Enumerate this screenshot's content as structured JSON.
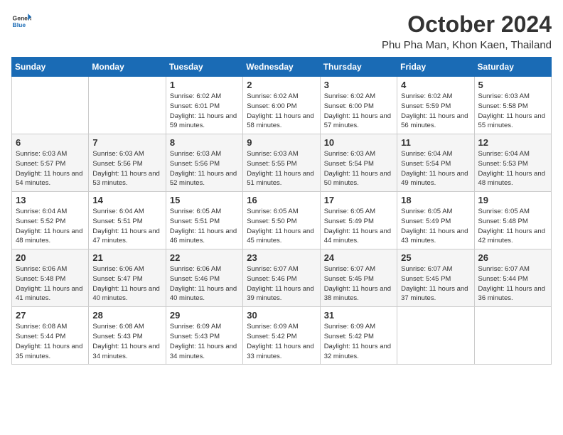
{
  "header": {
    "logo_general": "General",
    "logo_blue": "Blue",
    "month_title": "October 2024",
    "location": "Phu Pha Man, Khon Kaen, Thailand"
  },
  "weekdays": [
    "Sunday",
    "Monday",
    "Tuesday",
    "Wednesday",
    "Thursday",
    "Friday",
    "Saturday"
  ],
  "weeks": [
    [
      {
        "day": "",
        "info": ""
      },
      {
        "day": "",
        "info": ""
      },
      {
        "day": "1",
        "info": "Sunrise: 6:02 AM\nSunset: 6:01 PM\nDaylight: 11 hours and 59 minutes."
      },
      {
        "day": "2",
        "info": "Sunrise: 6:02 AM\nSunset: 6:00 PM\nDaylight: 11 hours and 58 minutes."
      },
      {
        "day": "3",
        "info": "Sunrise: 6:02 AM\nSunset: 6:00 PM\nDaylight: 11 hours and 57 minutes."
      },
      {
        "day": "4",
        "info": "Sunrise: 6:02 AM\nSunset: 5:59 PM\nDaylight: 11 hours and 56 minutes."
      },
      {
        "day": "5",
        "info": "Sunrise: 6:03 AM\nSunset: 5:58 PM\nDaylight: 11 hours and 55 minutes."
      }
    ],
    [
      {
        "day": "6",
        "info": "Sunrise: 6:03 AM\nSunset: 5:57 PM\nDaylight: 11 hours and 54 minutes."
      },
      {
        "day": "7",
        "info": "Sunrise: 6:03 AM\nSunset: 5:56 PM\nDaylight: 11 hours and 53 minutes."
      },
      {
        "day": "8",
        "info": "Sunrise: 6:03 AM\nSunset: 5:56 PM\nDaylight: 11 hours and 52 minutes."
      },
      {
        "day": "9",
        "info": "Sunrise: 6:03 AM\nSunset: 5:55 PM\nDaylight: 11 hours and 51 minutes."
      },
      {
        "day": "10",
        "info": "Sunrise: 6:03 AM\nSunset: 5:54 PM\nDaylight: 11 hours and 50 minutes."
      },
      {
        "day": "11",
        "info": "Sunrise: 6:04 AM\nSunset: 5:54 PM\nDaylight: 11 hours and 49 minutes."
      },
      {
        "day": "12",
        "info": "Sunrise: 6:04 AM\nSunset: 5:53 PM\nDaylight: 11 hours and 48 minutes."
      }
    ],
    [
      {
        "day": "13",
        "info": "Sunrise: 6:04 AM\nSunset: 5:52 PM\nDaylight: 11 hours and 48 minutes."
      },
      {
        "day": "14",
        "info": "Sunrise: 6:04 AM\nSunset: 5:51 PM\nDaylight: 11 hours and 47 minutes."
      },
      {
        "day": "15",
        "info": "Sunrise: 6:05 AM\nSunset: 5:51 PM\nDaylight: 11 hours and 46 minutes."
      },
      {
        "day": "16",
        "info": "Sunrise: 6:05 AM\nSunset: 5:50 PM\nDaylight: 11 hours and 45 minutes."
      },
      {
        "day": "17",
        "info": "Sunrise: 6:05 AM\nSunset: 5:49 PM\nDaylight: 11 hours and 44 minutes."
      },
      {
        "day": "18",
        "info": "Sunrise: 6:05 AM\nSunset: 5:49 PM\nDaylight: 11 hours and 43 minutes."
      },
      {
        "day": "19",
        "info": "Sunrise: 6:05 AM\nSunset: 5:48 PM\nDaylight: 11 hours and 42 minutes."
      }
    ],
    [
      {
        "day": "20",
        "info": "Sunrise: 6:06 AM\nSunset: 5:48 PM\nDaylight: 11 hours and 41 minutes."
      },
      {
        "day": "21",
        "info": "Sunrise: 6:06 AM\nSunset: 5:47 PM\nDaylight: 11 hours and 40 minutes."
      },
      {
        "day": "22",
        "info": "Sunrise: 6:06 AM\nSunset: 5:46 PM\nDaylight: 11 hours and 40 minutes."
      },
      {
        "day": "23",
        "info": "Sunrise: 6:07 AM\nSunset: 5:46 PM\nDaylight: 11 hours and 39 minutes."
      },
      {
        "day": "24",
        "info": "Sunrise: 6:07 AM\nSunset: 5:45 PM\nDaylight: 11 hours and 38 minutes."
      },
      {
        "day": "25",
        "info": "Sunrise: 6:07 AM\nSunset: 5:45 PM\nDaylight: 11 hours and 37 minutes."
      },
      {
        "day": "26",
        "info": "Sunrise: 6:07 AM\nSunset: 5:44 PM\nDaylight: 11 hours and 36 minutes."
      }
    ],
    [
      {
        "day": "27",
        "info": "Sunrise: 6:08 AM\nSunset: 5:44 PM\nDaylight: 11 hours and 35 minutes."
      },
      {
        "day": "28",
        "info": "Sunrise: 6:08 AM\nSunset: 5:43 PM\nDaylight: 11 hours and 34 minutes."
      },
      {
        "day": "29",
        "info": "Sunrise: 6:09 AM\nSunset: 5:43 PM\nDaylight: 11 hours and 34 minutes."
      },
      {
        "day": "30",
        "info": "Sunrise: 6:09 AM\nSunset: 5:42 PM\nDaylight: 11 hours and 33 minutes."
      },
      {
        "day": "31",
        "info": "Sunrise: 6:09 AM\nSunset: 5:42 PM\nDaylight: 11 hours and 32 minutes."
      },
      {
        "day": "",
        "info": ""
      },
      {
        "day": "",
        "info": ""
      }
    ]
  ]
}
